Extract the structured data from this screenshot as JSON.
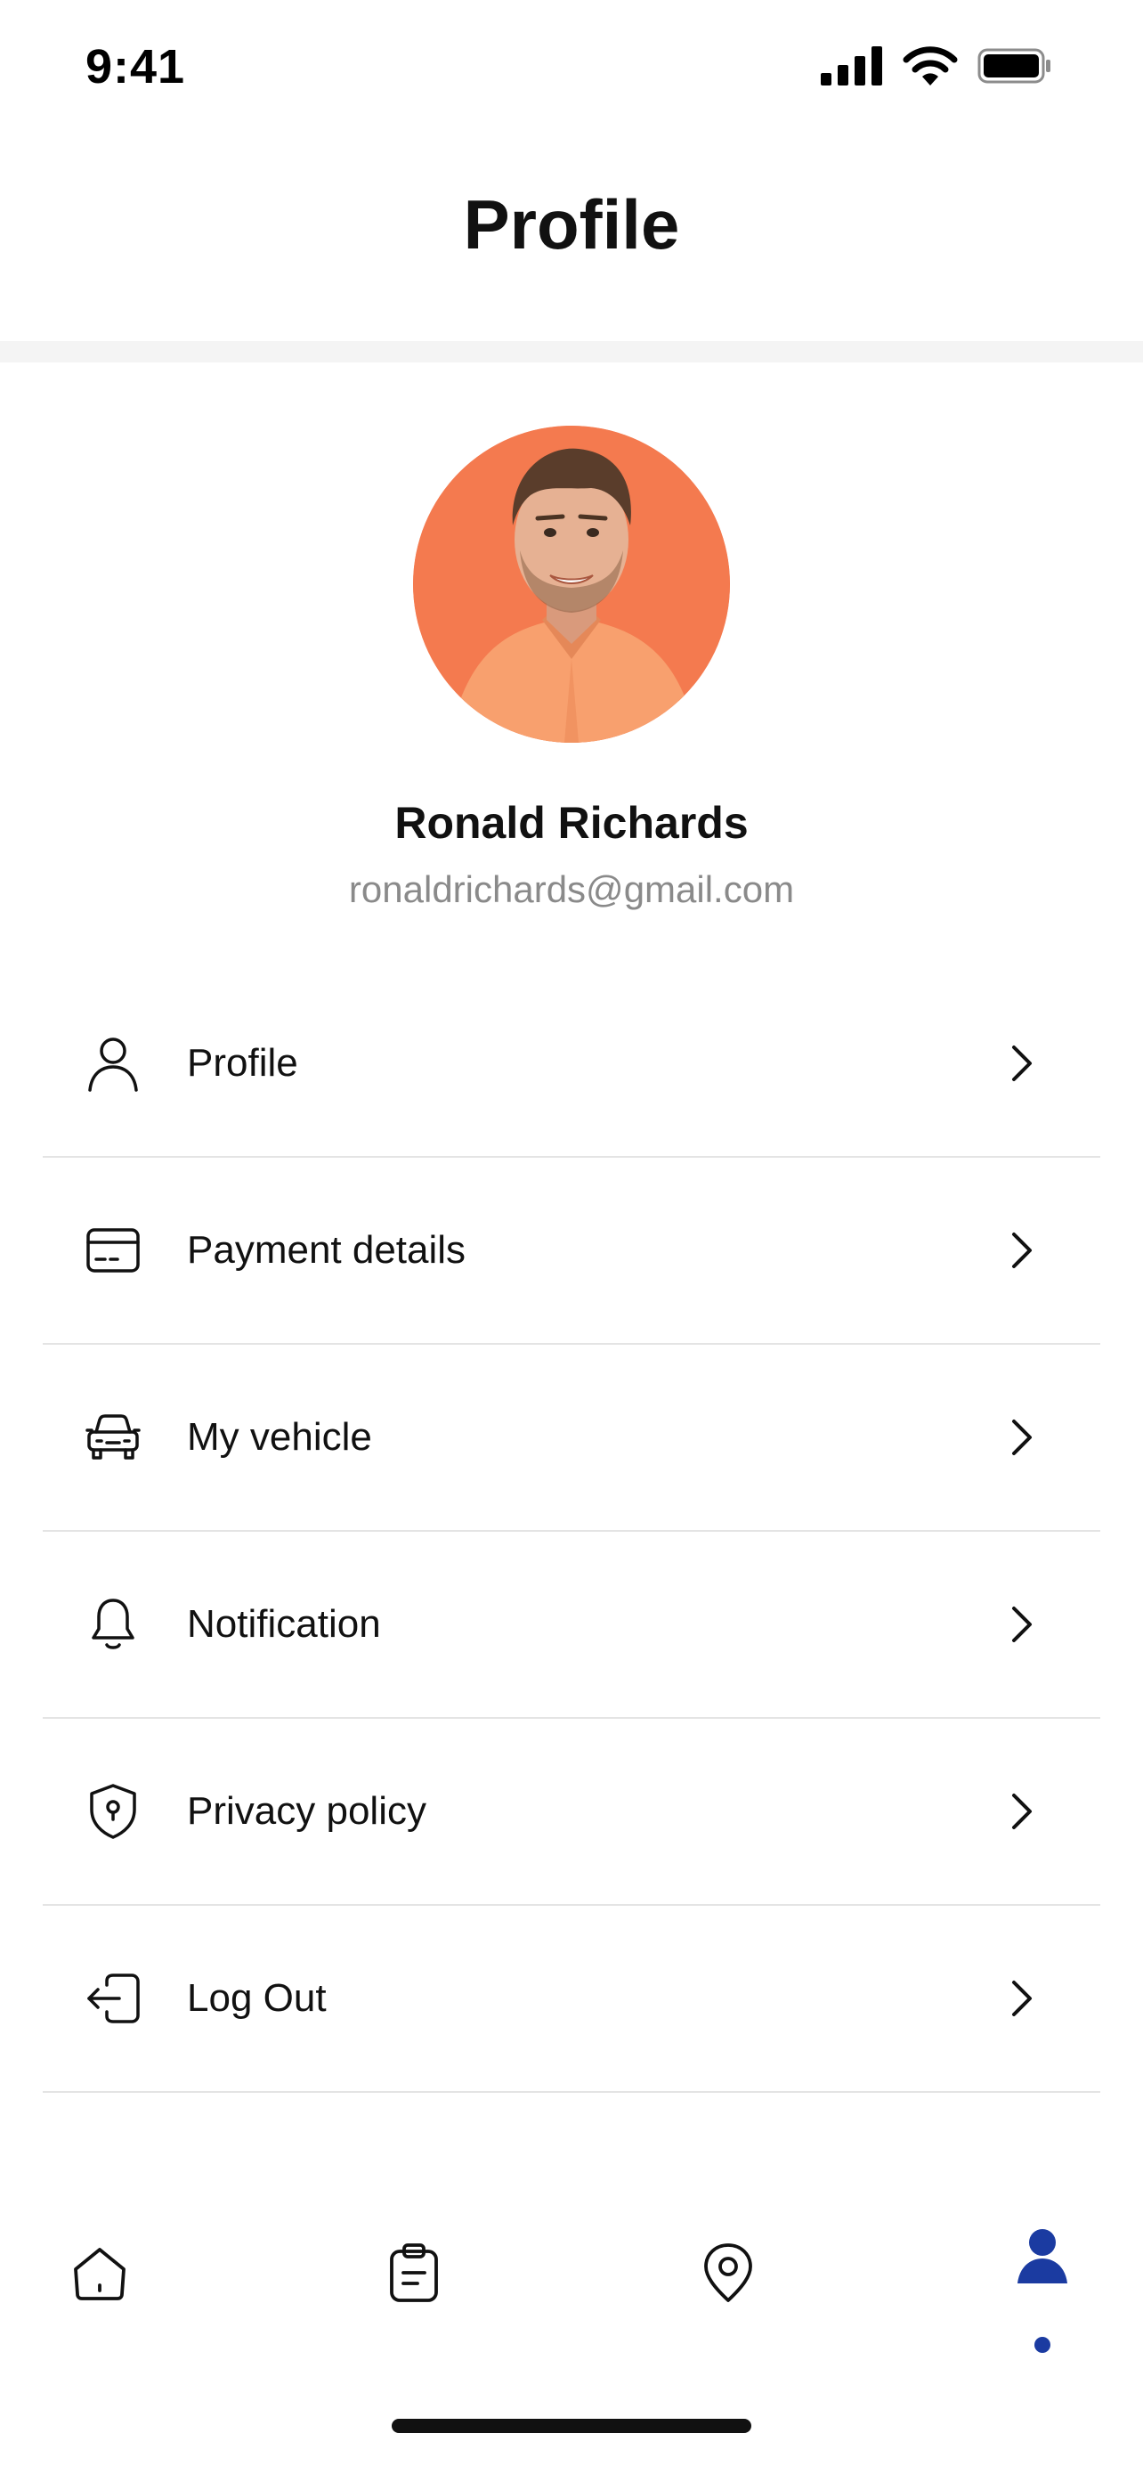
{
  "status_bar": {
    "time": "9:41",
    "icons": [
      "signal-icon",
      "wifi-icon",
      "battery-icon"
    ]
  },
  "header": {
    "title": "Profile"
  },
  "user": {
    "name": "Ronald Richards",
    "email": "ronaldrichards@gmail.com",
    "avatar_bg": "#f47a4f"
  },
  "menu": {
    "items": [
      {
        "label": "Profile",
        "icon": "user-icon"
      },
      {
        "label": "Payment details",
        "icon": "card-icon"
      },
      {
        "label": "My vehicle",
        "icon": "car-icon"
      },
      {
        "label": "Notification",
        "icon": "bell-icon"
      },
      {
        "label": "Privacy policy",
        "icon": "shield-icon"
      },
      {
        "label": "Log Out",
        "icon": "logout-icon"
      }
    ]
  },
  "bottom_nav": {
    "items": [
      {
        "name": "home",
        "icon": "home-icon",
        "active": false
      },
      {
        "name": "orders",
        "icon": "clipboard-icon",
        "active": false
      },
      {
        "name": "location",
        "icon": "location-pin-icon",
        "active": false
      },
      {
        "name": "profile",
        "icon": "user-filled-icon",
        "active": true
      }
    ],
    "active_color": "#1b3ba1"
  }
}
